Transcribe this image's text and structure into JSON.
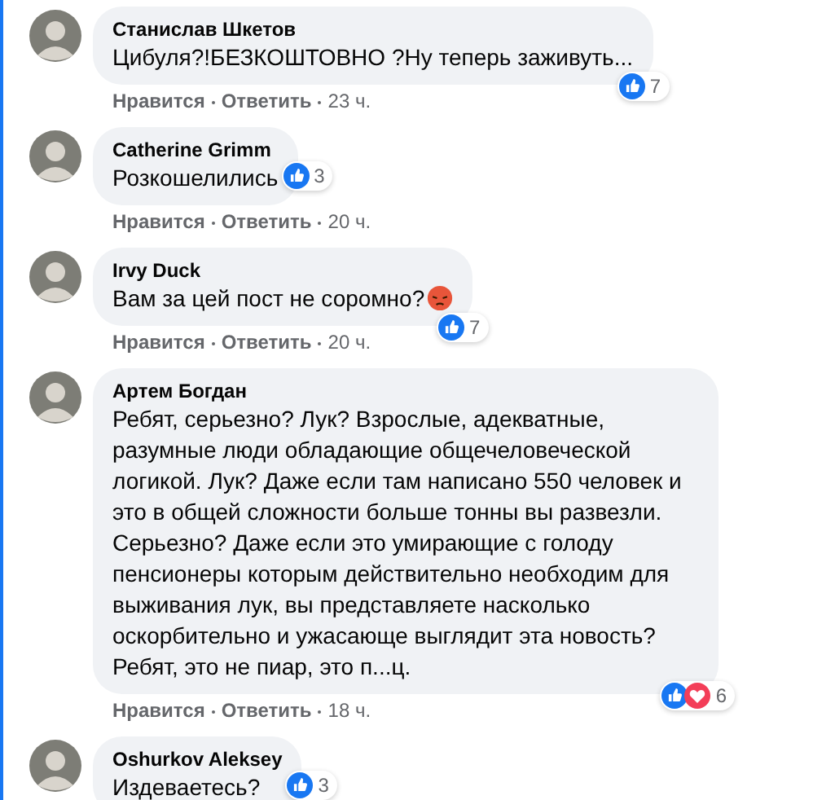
{
  "comments": [
    {
      "author": "Станислав Шкетов",
      "text": "Цибуля?!БЕЗКОШТОВНО ?Ну теперь заживуть...",
      "angry_emoji": false,
      "reactions": {
        "like": true,
        "love": false,
        "count": "7"
      },
      "actions": [
        "Нравится",
        "Ответить"
      ],
      "time": "23 ч."
    },
    {
      "author": "Catherine Grimm",
      "text": "Розкошелились",
      "angry_emoji": false,
      "reactions": {
        "like": true,
        "love": false,
        "count": "3"
      },
      "actions": [
        "Нравится",
        "Ответить"
      ],
      "time": "20 ч."
    },
    {
      "author": "Irvy Duck",
      "text": "Вам за цей пост не соромно?",
      "angry_emoji": true,
      "reactions": {
        "like": true,
        "love": false,
        "count": "7"
      },
      "actions": [
        "Нравится",
        "Ответить"
      ],
      "time": "20 ч."
    },
    {
      "author": "Артем Богдан",
      "text": "Ребят, серьезно? Лук? Взрослые, адекватные, разумные люди обладающие общечеловеческой логикой. Лук? Даже если там написано 550 человек и это в общей сложности больше тонны вы развезли. Серьезно? Даже если это умирающие с голоду пенсионеры которым действительно необходим для выживания лук, вы представляете насколько оскорбительно и ужасающе выглядит эта новость? Ребят, это не пиар, это п...ц.",
      "angry_emoji": false,
      "reactions": {
        "like": true,
        "love": true,
        "count": "6"
      },
      "actions": [
        "Нравится",
        "Ответить"
      ],
      "time": "18 ч."
    },
    {
      "author": "Oshurkov Aleksey",
      "text": "Издеваетесь?",
      "angry_emoji": false,
      "reactions": {
        "like": true,
        "love": false,
        "count": "3"
      }
    }
  ]
}
